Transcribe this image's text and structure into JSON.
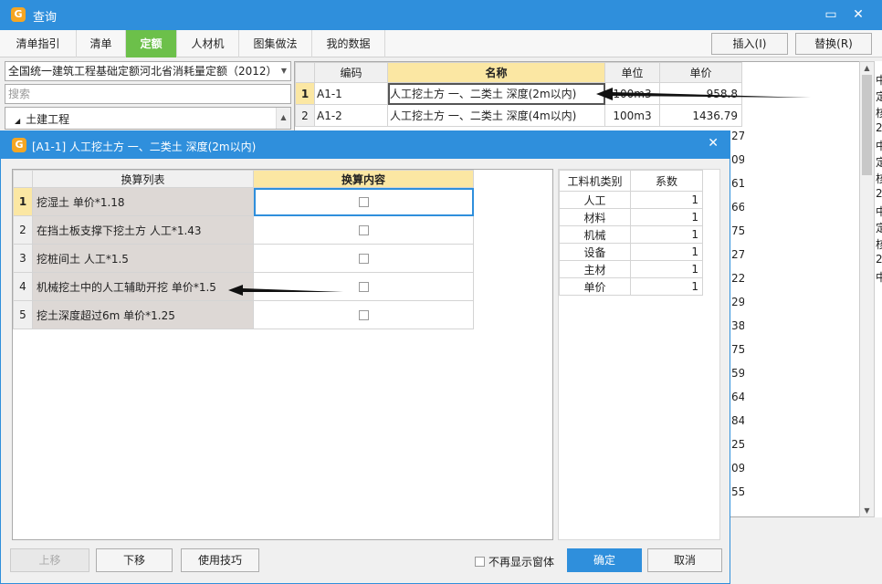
{
  "window": {
    "title": "查询"
  },
  "tabs": [
    {
      "label": "清单指引",
      "active": false
    },
    {
      "label": "清单",
      "active": false
    },
    {
      "label": "定额",
      "active": true
    },
    {
      "label": "人材机",
      "active": false
    },
    {
      "label": "图集做法",
      "active": false
    },
    {
      "label": "我的数据",
      "active": false
    }
  ],
  "toolbar": {
    "insert_label": "插入(I)",
    "replace_label": "替换(R)"
  },
  "left": {
    "quota_select": "全国统一建筑工程基础定额河北省消耗量定额（2012）",
    "search_placeholder": "搜索",
    "tree_item": "土建工程"
  },
  "main_grid": {
    "headers": {
      "code": "编码",
      "name": "名称",
      "unit": "单位",
      "price": "单价"
    },
    "rows": [
      {
        "num": "1",
        "code": "A1-1",
        "name": "人工挖土方 一、二类土 深度(2m以内)",
        "unit": "100m3",
        "price": "958.8"
      },
      {
        "num": "2",
        "code": "A1-2",
        "name": "人工挖土方 一、二类土 深度(4m以内)",
        "unit": "100m3",
        "price": "1436.79"
      }
    ],
    "price_fragments": [
      "27",
      "09",
      "61",
      "66",
      "75",
      "27",
      "22",
      "29",
      "38",
      "75",
      "59",
      "64",
      "84",
      "25",
      "09",
      "55"
    ]
  },
  "peek_text": [
    "中",
    "定",
    "核",
    "2",
    "中",
    "定",
    "核",
    "2",
    "中",
    "定",
    "核",
    "2",
    "中"
  ],
  "dialog": {
    "title": "[A1-1] 人工挖土方 一、二类土 深度(2m以内)",
    "conv_headers": {
      "list": "换算列表",
      "content": "换算内容"
    },
    "conversions": [
      {
        "num": "1",
        "text": "挖湿土 单价*1.18"
      },
      {
        "num": "2",
        "text": "在挡土板支撑下挖土方 人工*1.43"
      },
      {
        "num": "3",
        "text": "挖桩间土 人工*1.5"
      },
      {
        "num": "4",
        "text": "机械挖土中的人工辅助开挖 单价*1.5"
      },
      {
        "num": "5",
        "text": "挖土深度超过6m 单价*1.25"
      }
    ],
    "coef_headers": {
      "cat": "工料机类别",
      "coef": "系数"
    },
    "coefficients": [
      {
        "cat": "人工",
        "coef": "1"
      },
      {
        "cat": "材料",
        "coef": "1"
      },
      {
        "cat": "机械",
        "coef": "1"
      },
      {
        "cat": "设备",
        "coef": "1"
      },
      {
        "cat": "主材",
        "coef": "1"
      },
      {
        "cat": "单价",
        "coef": "1"
      }
    ],
    "buttons": {
      "up": "上移",
      "down": "下移",
      "tips": "使用技巧",
      "no_show": "不再显示窗体",
      "ok": "确定",
      "cancel": "取消"
    }
  }
}
